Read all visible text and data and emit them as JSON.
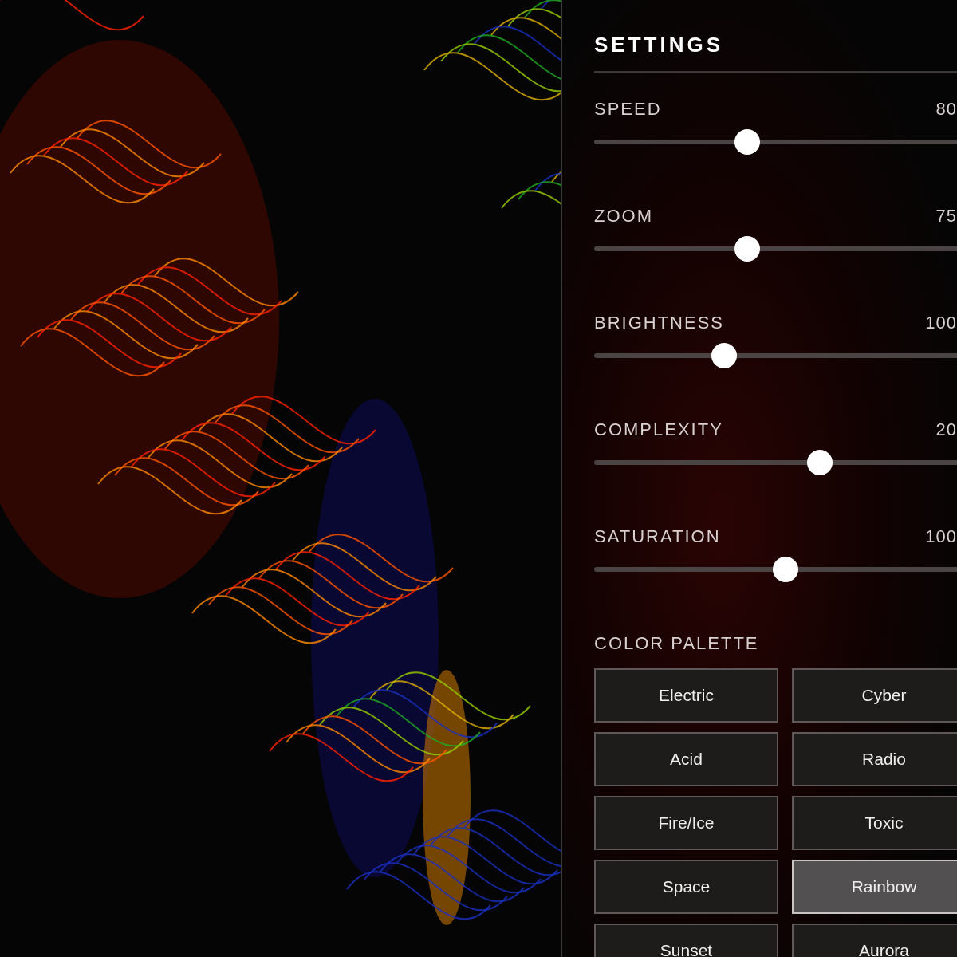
{
  "settings": {
    "title": "SETTINGS",
    "sliders": [
      {
        "label": "SPEED",
        "reading": "80",
        "level": 0.4
      },
      {
        "label": "ZOOM",
        "reading": "75",
        "level": 0.4
      },
      {
        "label": "BRIGHTNESS",
        "reading": "100",
        "level": 0.34
      },
      {
        "label": "COMPLEXITY",
        "reading": "20",
        "level": 0.59
      },
      {
        "label": "SATURATION",
        "reading": "100",
        "level": 0.5
      }
    ],
    "palette": {
      "label": "COLOR PALETTE",
      "options": [
        {
          "label": "Electric",
          "selected": false
        },
        {
          "label": "Cyber",
          "selected": false
        },
        {
          "label": "Acid",
          "selected": false
        },
        {
          "label": "Radio",
          "selected": false
        },
        {
          "label": "Fire/Ice",
          "selected": false
        },
        {
          "label": "Toxic",
          "selected": false
        },
        {
          "label": "Space",
          "selected": false
        },
        {
          "label": "Rainbow",
          "selected": true
        },
        {
          "label": "Sunset",
          "selected": false
        },
        {
          "label": "Aurora",
          "selected": false
        }
      ]
    }
  }
}
